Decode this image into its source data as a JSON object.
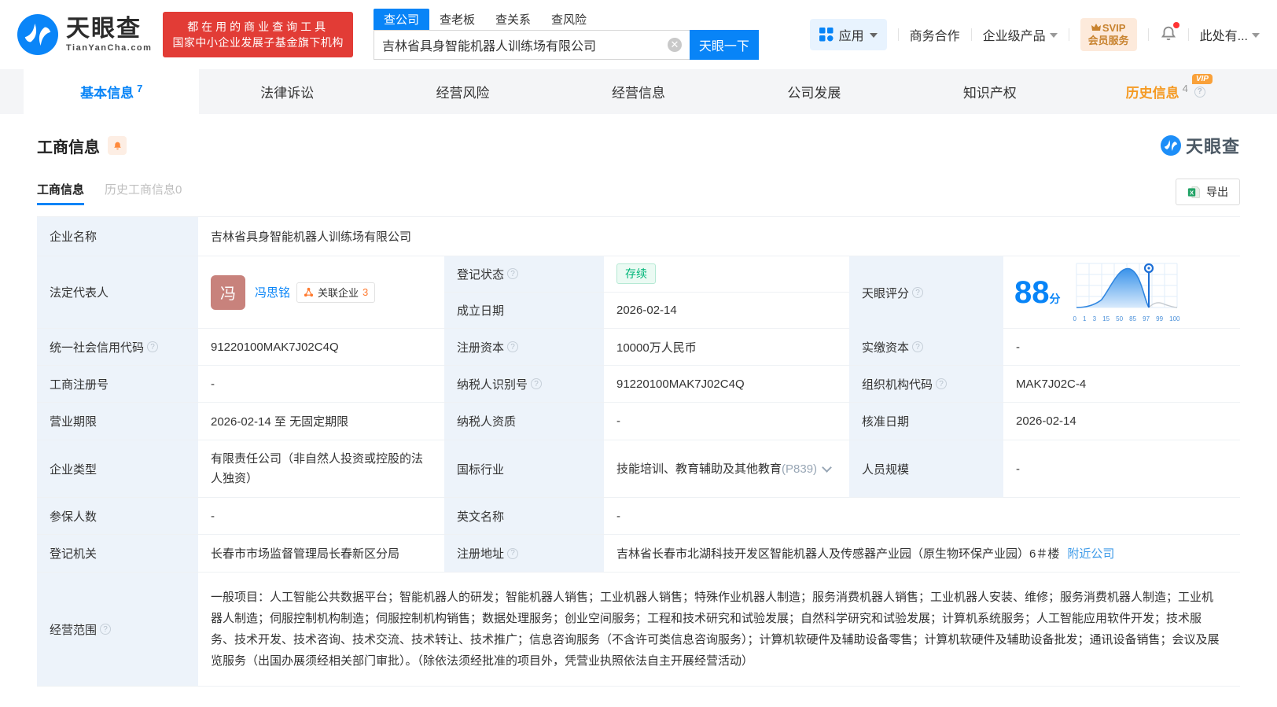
{
  "colors": {
    "brand_blue": "#0884f7",
    "promo_red": "#e23c36",
    "vip_orange": "#f9a13a",
    "status_green": "#00b578",
    "label_bg": "#edf3fa",
    "link_blue": "#3d9ae8"
  },
  "header": {
    "logo": {
      "brand": "天眼查",
      "domain": "TianYanCha.com"
    },
    "promo": {
      "line1": "都在用的商业查询工具",
      "line2": "国家中小企业发展子基金旗下机构"
    },
    "search": {
      "tabs": [
        {
          "label": "查公司"
        },
        {
          "label": "查老板"
        },
        {
          "label": "查关系"
        },
        {
          "label": "查风险"
        }
      ],
      "value": "吉林省具身智能机器人训练场有限公司",
      "button": "天眼一下"
    },
    "nav": {
      "apps": "应用",
      "cooperation": "商务合作",
      "enterprise": "企业级产品",
      "svip_line1": "SVIP",
      "svip_line2": "会员服务",
      "user": "此处有..."
    }
  },
  "tabs": [
    {
      "label": "基本信息",
      "count": "7"
    },
    {
      "label": "法律诉讼"
    },
    {
      "label": "经营风险"
    },
    {
      "label": "经营信息"
    },
    {
      "label": "公司发展"
    },
    {
      "label": "知识产权"
    },
    {
      "label": "历史信息",
      "count": "4",
      "vip": "VIP"
    }
  ],
  "section": {
    "title": "工商信息",
    "watermark": "天眼查",
    "subtabs": {
      "current": "工商信息",
      "history": "历史工商信息0"
    },
    "export": "导出"
  },
  "table": {
    "r1": {
      "label": "企业名称",
      "value": "吉林省具身智能机器人训练场有限公司"
    },
    "legal": {
      "label": "法定代表人",
      "avatar": "冯",
      "name": "冯思铭",
      "badge_label": "关联企业",
      "badge_count": "3"
    },
    "status": {
      "label": "登记状态",
      "value": "存续"
    },
    "established": {
      "label": "成立日期",
      "value": "2026-02-14"
    },
    "score": {
      "label": "天眼评分",
      "value": "88",
      "unit": "分",
      "axis": [
        "0",
        "1",
        "3",
        "15",
        "50",
        "85",
        "97",
        "99",
        "100"
      ]
    },
    "r3": [
      {
        "label": "统一社会信用代码",
        "value": "91220100MAK7J02C4Q"
      },
      {
        "label": "注册资本",
        "value": "10000万人民币"
      },
      {
        "label": "实缴资本",
        "value": "-"
      }
    ],
    "r4": [
      {
        "label": "工商注册号",
        "value": "-"
      },
      {
        "label": "纳税人识别号",
        "value": "91220100MAK7J02C4Q"
      },
      {
        "label": "组织机构代码",
        "value": "MAK7J02C-4"
      }
    ],
    "r5": [
      {
        "label": "营业期限",
        "value": "2026-02-14 至 无固定期限"
      },
      {
        "label": "纳税人资质",
        "value": "-"
      },
      {
        "label": "核准日期",
        "value": "2026-02-14"
      }
    ],
    "r6": [
      {
        "label": "企业类型",
        "value": "有限责任公司（非自然人投资或控股的法人独资）"
      },
      {
        "label": "国标行业",
        "value": "技能培训、教育辅助及其他教育",
        "code": "(P839)"
      },
      {
        "label": "人员规模",
        "value": "-"
      }
    ],
    "r7": [
      {
        "label": "参保人数",
        "value": "-"
      },
      {
        "label": "英文名称",
        "value": "-"
      }
    ],
    "r8": {
      "label": "登记机关",
      "value": "长春市市场监督管理局长春新区分局",
      "addr_label": "注册地址",
      "addr_value": "吉林省长春市北湖科技开发区智能机器人及传感器产业园（原生物环保产业园）6＃楼",
      "addr_link": "附近公司"
    },
    "r9": {
      "label": "经营范围",
      "value": "一般项目：人工智能公共数据平台；智能机器人的研发；智能机器人销售；工业机器人销售；特殊作业机器人制造；服务消费机器人销售；工业机器人安装、维修；服务消费机器人制造；工业机器人制造；伺服控制机构制造；伺服控制机构销售；数据处理服务；创业空间服务；工程和技术研究和试验发展；自然科学研究和试验发展；计算机系统服务；人工智能应用软件开发；技术服务、技术开发、技术咨询、技术交流、技术转让、技术推广；信息咨询服务（不含许可类信息咨询服务）；计算机软硬件及辅助设备零售；计算机软硬件及辅助设备批发；通讯设备销售；会议及展览服务（出国办展须经相关部门审批）。（除依法须经批准的项目外，凭营业执照依法自主开展经营活动）"
    }
  }
}
